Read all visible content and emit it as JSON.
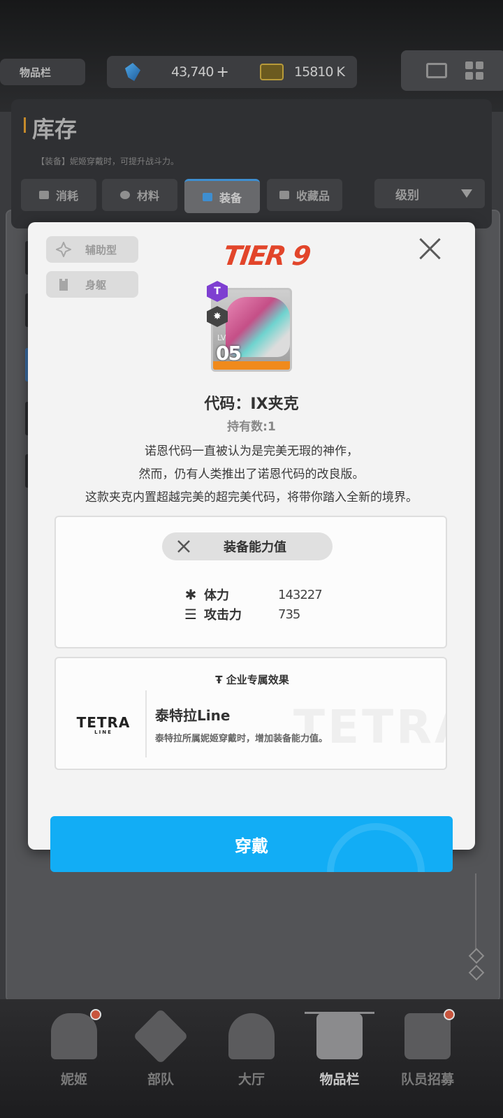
{
  "topbar": {
    "inventory_label": "物品栏",
    "gem_count": "43,740",
    "plus": "+",
    "card_count": "15810 K",
    "gem_icon": "gem-icon",
    "card_icon": "credit-card-icon",
    "mail_icon": "mail-icon",
    "menu_icon": "grid-menu-icon"
  },
  "inventory": {
    "title": "库存",
    "subtitle": "【装备】妮姬穿戴时，可提升战斗力。",
    "tabs": [
      {
        "label": "消耗",
        "icon": "consumable-icon"
      },
      {
        "label": "材料",
        "icon": "material-icon"
      },
      {
        "label": "装备",
        "icon": "equipment-icon",
        "active": true
      },
      {
        "label": "收藏品",
        "icon": "collectible-icon"
      }
    ],
    "sort_label": "级别"
  },
  "dialog": {
    "tags": [
      {
        "label": "辅助型",
        "icon": "supporter-icon"
      },
      {
        "label": "身躯",
        "icon": "body-armor-icon"
      }
    ],
    "tier": "TIER 9",
    "item": {
      "level_label": "LV",
      "level": "05",
      "badge_t": "T"
    },
    "name": "代码：IX夹克",
    "owned": "持有数:1",
    "description": [
      "诺恩代码一直被认为是完美无瑕的神作，",
      "然而，仍有人类推出了诺恩代码的改良版。",
      "这款夹克内置超越完美的超完美代码，将带你踏入全新的境界。"
    ],
    "stats": {
      "title": "装备能力值",
      "rows": [
        {
          "label": "体力",
          "value": "143227",
          "icon": "hp-icon"
        },
        {
          "label": "攻击力",
          "value": "735",
          "icon": "attack-icon"
        }
      ]
    },
    "corp": {
      "header": "企业专属效果",
      "logo": "TETRA",
      "logo_sub": "LINE",
      "name": "泰特拉Line",
      "desc": "泰特拉所属妮姬穿戴时，增加装备能力值。",
      "watermark": "TETRA"
    },
    "wear_button": "穿戴"
  },
  "bottom_nav": [
    {
      "label": "妮姬",
      "icon": "nikke-icon",
      "dot": true
    },
    {
      "label": "部队",
      "icon": "squad-icon"
    },
    {
      "label": "大厅",
      "icon": "lobby-icon"
    },
    {
      "label": "物品栏",
      "icon": "inventory-icon",
      "active": true
    },
    {
      "label": "队员招募",
      "icon": "recruit-icon",
      "dot": true
    }
  ]
}
